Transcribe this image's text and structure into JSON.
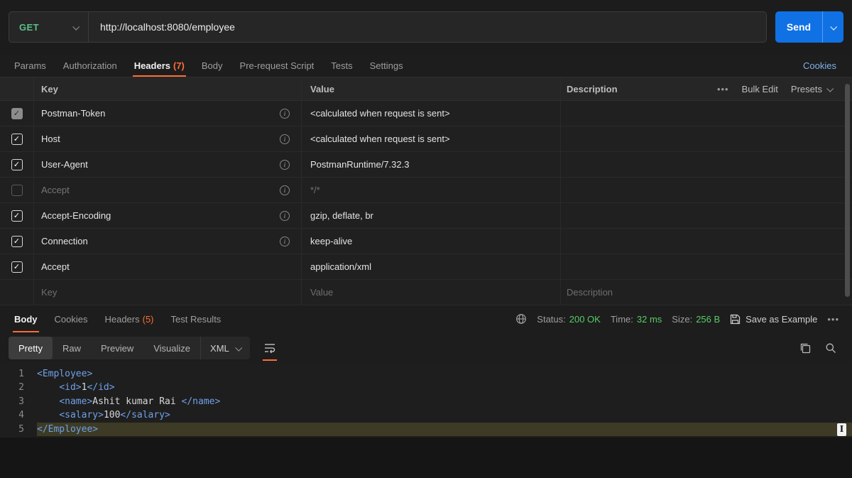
{
  "colors": {
    "accent_orange": "#ff6c37",
    "method_green": "#5bc089",
    "status_green": "#58cc66",
    "send_blue": "#1071e5",
    "link_blue": "#7fb0ea",
    "xml_tag_blue": "#6fa1e8",
    "highlight_line": "#3d3b25"
  },
  "icons": {
    "info_glyph": "i",
    "check_glyph": "✓",
    "dots": "•••",
    "ibeam_glyph": "I"
  },
  "request": {
    "method": "GET",
    "url": "http://localhost:8080/employee",
    "send_label": "Send"
  },
  "request_tabs": {
    "items": [
      {
        "label": "Params",
        "count": "",
        "active": false
      },
      {
        "label": "Authorization",
        "count": "",
        "active": false
      },
      {
        "label": "Headers",
        "count": "(7)",
        "active": true
      },
      {
        "label": "Body",
        "count": "",
        "active": false
      },
      {
        "label": "Pre-request Script",
        "count": "",
        "active": false
      },
      {
        "label": "Tests",
        "count": "",
        "active": false
      },
      {
        "label": "Settings",
        "count": "",
        "active": false
      }
    ],
    "cookies_link": "Cookies"
  },
  "headers_table": {
    "columns": {
      "key": "Key",
      "value": "Value",
      "description": "Description"
    },
    "more_dots": "•••",
    "bulk_edit_label": "Bulk Edit",
    "presets_label": "Presets",
    "rows": [
      {
        "key": "Postman-Token",
        "value": "<calculated when request is sent>",
        "description": "",
        "checked": true,
        "disabled": true,
        "muted": false,
        "info": true
      },
      {
        "key": "Host",
        "value": "<calculated when request is sent>",
        "description": "",
        "checked": true,
        "disabled": false,
        "muted": false,
        "info": true
      },
      {
        "key": "User-Agent",
        "value": "PostmanRuntime/7.32.3",
        "description": "",
        "checked": true,
        "disabled": false,
        "muted": false,
        "info": true
      },
      {
        "key": "Accept",
        "value": "*/*",
        "description": "",
        "checked": false,
        "disabled": false,
        "muted": true,
        "info": true
      },
      {
        "key": "Accept-Encoding",
        "value": "gzip, deflate, br",
        "description": "",
        "checked": true,
        "disabled": false,
        "muted": false,
        "info": true
      },
      {
        "key": "Connection",
        "value": "keep-alive",
        "description": "",
        "checked": true,
        "disabled": false,
        "muted": false,
        "info": true
      },
      {
        "key": "Accept",
        "value": "application/xml",
        "description": "",
        "checked": true,
        "disabled": false,
        "muted": false,
        "info": false
      }
    ],
    "placeholder_row": {
      "key": "Key",
      "value": "Value",
      "description": "Description"
    }
  },
  "response": {
    "tabs": [
      {
        "label": "Body",
        "count": "",
        "active": true
      },
      {
        "label": "Cookies",
        "count": "",
        "active": false
      },
      {
        "label": "Headers",
        "count": "(5)",
        "active": false
      },
      {
        "label": "Test Results",
        "count": "",
        "active": false
      }
    ],
    "meta": {
      "status_label": "Status:",
      "status_value": "200 OK",
      "time_label": "Time:",
      "time_value": "32 ms",
      "size_label": "Size:",
      "size_value": "256 B",
      "save_as_example": "Save as Example",
      "more_dots": "•••"
    },
    "view_tabs": [
      {
        "label": "Pretty",
        "active": true
      },
      {
        "label": "Raw",
        "active": false
      },
      {
        "label": "Preview",
        "active": false
      },
      {
        "label": "Visualize",
        "active": false
      }
    ],
    "format_select": "XML",
    "code_lines": [
      {
        "num": "1",
        "highlight": false,
        "segments": [
          {
            "t": "tag",
            "s": "<Employee>"
          }
        ]
      },
      {
        "num": "2",
        "highlight": false,
        "segments": [
          {
            "t": "plain",
            "s": "    "
          },
          {
            "t": "tag",
            "s": "<id>"
          },
          {
            "t": "plain",
            "s": "1"
          },
          {
            "t": "tag",
            "s": "</id>"
          }
        ]
      },
      {
        "num": "3",
        "highlight": false,
        "segments": [
          {
            "t": "plain",
            "s": "    "
          },
          {
            "t": "tag",
            "s": "<name>"
          },
          {
            "t": "plain",
            "s": "Ashit kumar Rai "
          },
          {
            "t": "tag",
            "s": "</name>"
          }
        ]
      },
      {
        "num": "4",
        "highlight": false,
        "segments": [
          {
            "t": "plain",
            "s": "    "
          },
          {
            "t": "tag",
            "s": "<salary>"
          },
          {
            "t": "plain",
            "s": "100"
          },
          {
            "t": "tag",
            "s": "</salary>"
          }
        ]
      },
      {
        "num": "5",
        "highlight": true,
        "segments": [
          {
            "t": "tag",
            "s": "</Employee>"
          }
        ]
      }
    ]
  }
}
